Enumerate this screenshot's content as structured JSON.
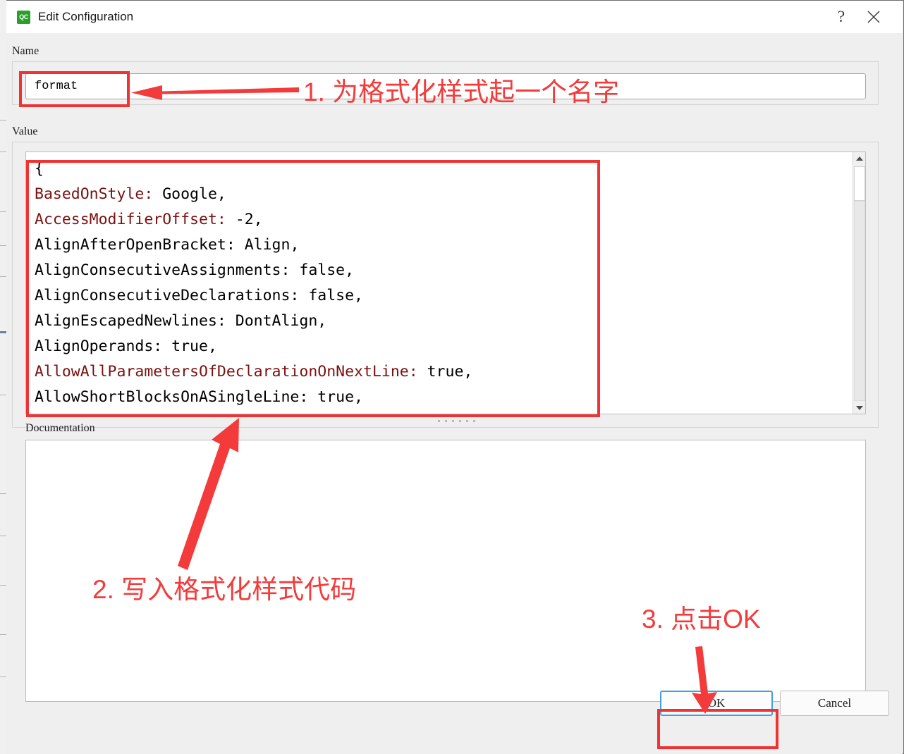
{
  "window": {
    "title": "Edit Configuration",
    "app_icon": "QC",
    "help_icon": "?",
    "close_icon": "close-x"
  },
  "form": {
    "name_label": "Name",
    "name_value": "format",
    "value_label": "Value",
    "documentation_label": "Documentation",
    "documentation_value": ""
  },
  "code": {
    "lines": [
      {
        "key": "{",
        "sep": "",
        "value": "",
        "highlight": false
      },
      {
        "key": "BasedOnStyle",
        "sep": ": ",
        "value": "Google,",
        "highlight": true
      },
      {
        "key": "AccessModifierOffset",
        "sep": ": ",
        "value": "-2,",
        "highlight": true
      },
      {
        "key": "AlignAfterOpenBracket",
        "sep": ": ",
        "value": "Align,",
        "highlight": false
      },
      {
        "key": "AlignConsecutiveAssignments",
        "sep": ": ",
        "value": "false,",
        "highlight": false
      },
      {
        "key": "AlignConsecutiveDeclarations",
        "sep": ": ",
        "value": "false,",
        "highlight": false
      },
      {
        "key": "AlignEscapedNewlines",
        "sep": ": ",
        "value": "DontAlign,",
        "highlight": false
      },
      {
        "key": "AlignOperands",
        "sep": ": ",
        "value": "true,",
        "highlight": false
      },
      {
        "key": "AllowAllParametersOfDeclarationOnNextLine",
        "sep": ": ",
        "value": "true,",
        "highlight": true
      },
      {
        "key": "AllowShortBlocksOnASingleLine",
        "sep": ": ",
        "value": "true,",
        "highlight": false
      }
    ]
  },
  "scrollbar": {
    "up_arrow": "triangle-up",
    "down_arrow": "triangle-down"
  },
  "buttons": {
    "ok": "OK",
    "cancel": "Cancel"
  },
  "annotations": [
    {
      "id": "step1",
      "text": "1. 为格式化样式起一个名字"
    },
    {
      "id": "step2",
      "text": "2. 写入格式化样式代码"
    },
    {
      "id": "step3",
      "text": "3. 点击OK"
    }
  ],
  "colors": {
    "annotation_red": "#f43b3b",
    "highlight_box_red": "#f03232",
    "code_key_highlight": "#7c1010",
    "focus_blue": "#46a0e0",
    "app_icon_green": "#2aa02a"
  }
}
